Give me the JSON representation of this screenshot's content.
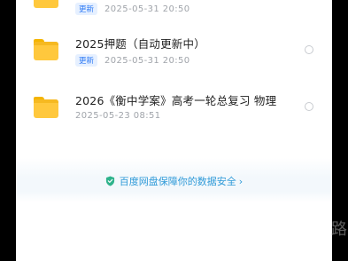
{
  "files": [
    {
      "name": "",
      "badge": "更新",
      "date": "2025-05-31  20:50",
      "icon": "folder-icon"
    },
    {
      "name": "2025押题（自动更新中）",
      "badge": "更新",
      "date": "2025-05-31  20:50",
      "icon": "folder-icon"
    },
    {
      "name": "2026《衡中学案》高考一轮总复习 物理",
      "badge": "",
      "date": "2025-05-23  08:51",
      "icon": "folder-icon"
    }
  ],
  "safety": {
    "text": "百度网盘保障你的数据安全",
    "icon": "shield-check-icon",
    "chevron": "›"
  },
  "watermark": "路",
  "colors": {
    "accent": "#2f7bf5",
    "folder": "#ffc83d",
    "safety": "#2f9ad8"
  }
}
